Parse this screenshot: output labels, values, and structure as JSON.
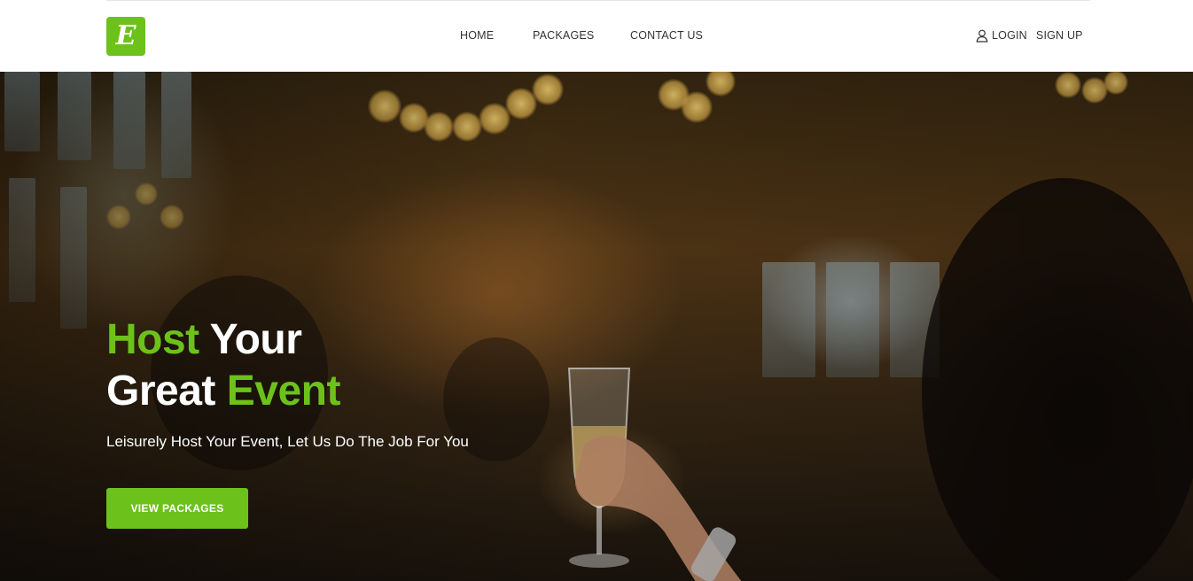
{
  "brand": {
    "logo_letter": "E",
    "accent_color": "#6cc21a"
  },
  "nav": {
    "items": [
      {
        "label": "HOME"
      },
      {
        "label": "PACKAGES"
      },
      {
        "label": "CONTACT US"
      }
    ]
  },
  "auth": {
    "icon": "user-icon",
    "login_label": "LOGIN",
    "signup_label": "SIGN UP"
  },
  "hero": {
    "title_line1_word1": "Host",
    "title_line1_word2": "Your",
    "title_line2_word1": "Great",
    "title_line2_word2": "Event",
    "subtitle": "Leisurely Host Your Event, Let Us Do The Job For You",
    "cta_label": "VIEW PACKAGES",
    "background": "banquet-toast-photo"
  }
}
